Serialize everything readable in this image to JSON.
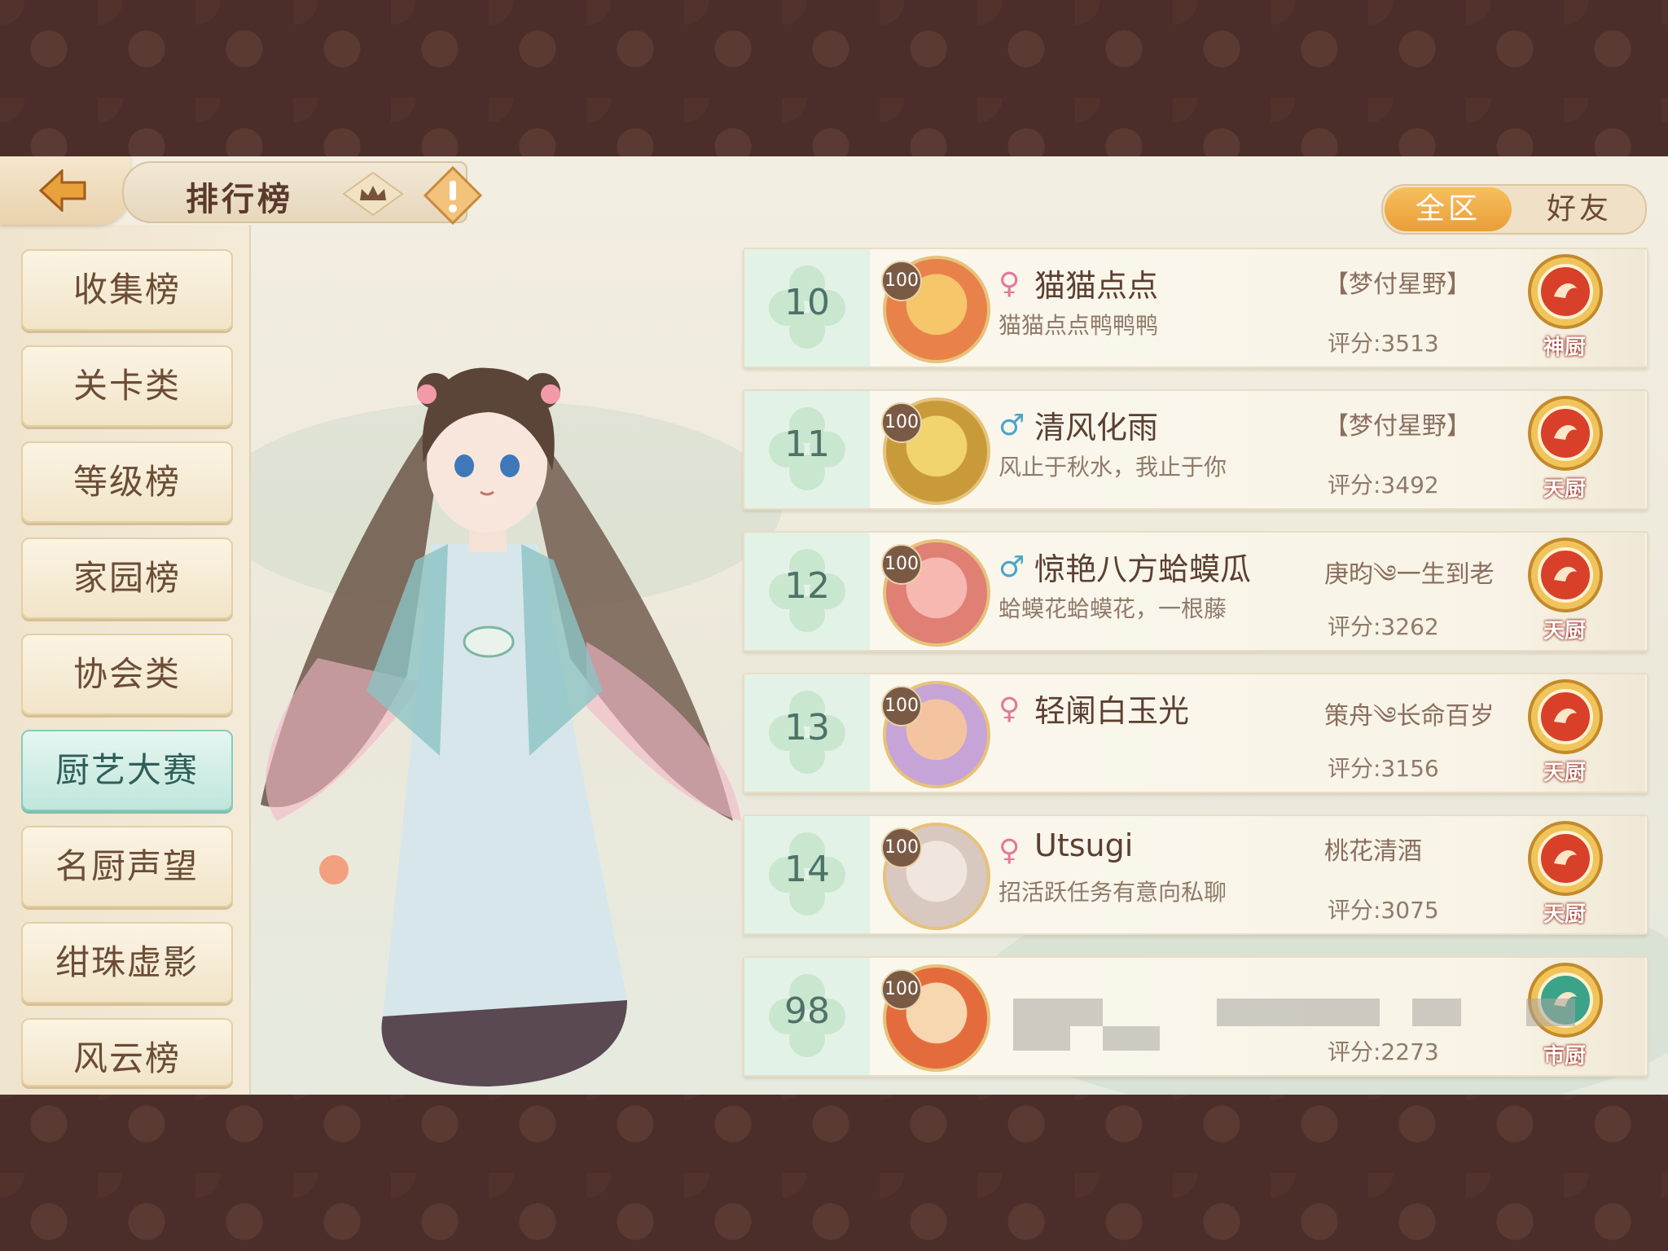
{
  "header": {
    "title": "排行榜",
    "toggle": {
      "active": "全区",
      "inactive": "好友"
    }
  },
  "sidebar": {
    "items": [
      {
        "label": "收集榜"
      },
      {
        "label": "关卡类"
      },
      {
        "label": "等级榜"
      },
      {
        "label": "家园榜"
      },
      {
        "label": "协会类"
      },
      {
        "label": "厨艺大赛"
      },
      {
        "label": "名厨声望"
      },
      {
        "label": "绀珠虚影"
      },
      {
        "label": "风云榜"
      }
    ],
    "active_index": 5
  },
  "rankings": [
    {
      "rank": "10",
      "level": "100",
      "gender": "♀",
      "name": "猫猫点点",
      "motto": "猫猫点点鸭鸭鸭",
      "guild": "【梦付星野】",
      "score": "评分:3513",
      "title": "神厨",
      "badge_color": "#d8402a"
    },
    {
      "rank": "11",
      "level": "100",
      "gender": "♂",
      "name": "清风化雨",
      "motto": "风止于秋水，我止于你",
      "guild": "【梦付星野】",
      "score": "评分:3492",
      "title": "天厨",
      "badge_color": "#d8402a"
    },
    {
      "rank": "12",
      "level": "100",
      "gender": "♂",
      "name": "惊艳八方蛤蟆瓜",
      "motto": "蛤蟆花蛤蟆花，一根藤",
      "guild": "庚昀༄一生到老",
      "score": "评分:3262",
      "title": "天厨",
      "badge_color": "#d8402a"
    },
    {
      "rank": "13",
      "level": "100",
      "gender": "♀",
      "name": "轻阑白玉光",
      "motto": "",
      "guild": "策舟༄长命百岁",
      "score": "评分:3156",
      "title": "天厨",
      "badge_color": "#d8402a"
    },
    {
      "rank": "14",
      "level": "100",
      "gender": "♀",
      "name": "Utsugi",
      "motto": "招活跃任务有意向私聊",
      "guild": "桃花清酒",
      "score": "评分:3075",
      "title": "天厨",
      "badge_color": "#d8402a"
    },
    {
      "rank": "98",
      "level": "100",
      "gender": "",
      "name": "",
      "motto": "",
      "guild": "",
      "score": "评分:2273",
      "title": "市厨",
      "badge_color": "#3aa38a"
    }
  ]
}
